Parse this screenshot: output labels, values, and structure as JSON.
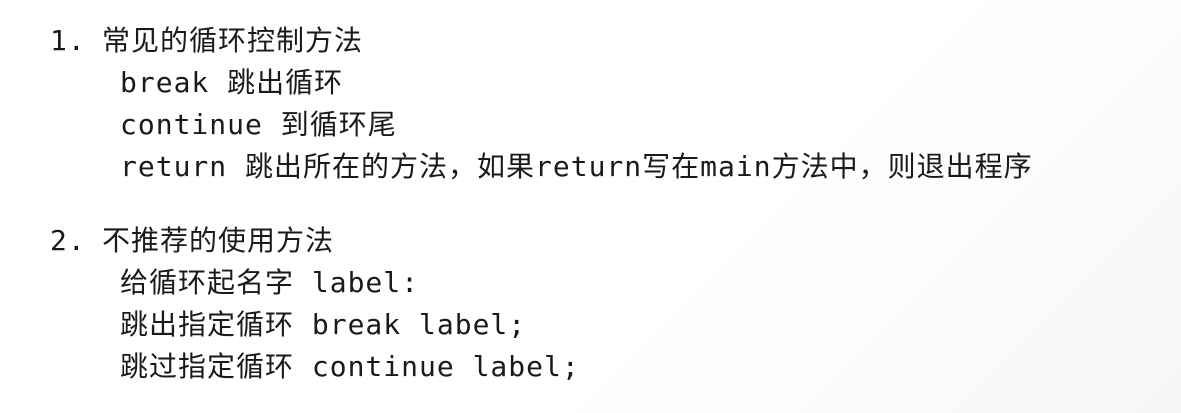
{
  "sections": [
    {
      "number": "1.",
      "title": "常见的循环控制方法",
      "items": [
        "break 跳出循环",
        "continue 到循环尾",
        "return 跳出所在的方法，如果return写在main方法中，则退出程序"
      ]
    },
    {
      "number": "2.",
      "title": "不推荐的使用方法",
      "items": [
        "给循环起名字 label:",
        "跳出指定循环 break label;",
        "跳过指定循环 continue label;"
      ]
    }
  ]
}
